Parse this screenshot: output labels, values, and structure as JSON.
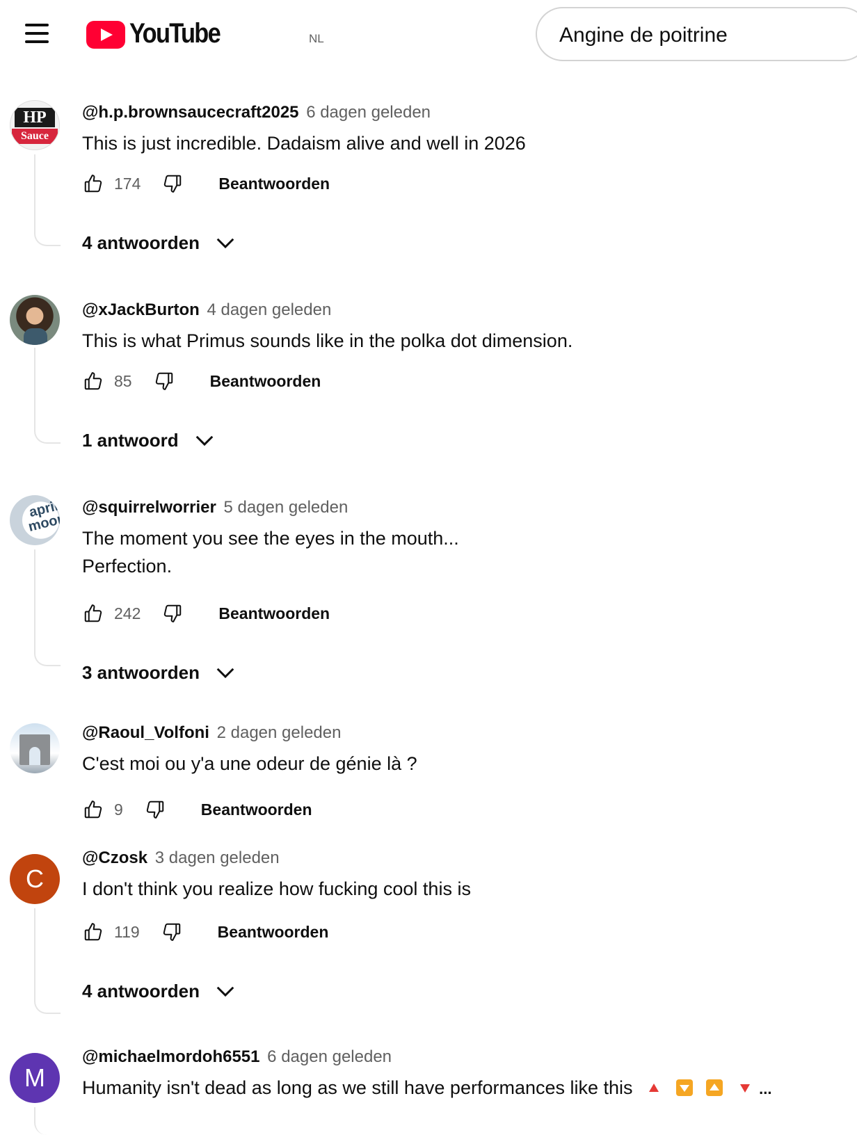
{
  "header": {
    "logo_text": "YouTube",
    "region": "NL",
    "search_value": "Angine de poitrine"
  },
  "comments": [
    {
      "author": "@h.p.brownsaucecraft2025",
      "time": "6 dagen geleden",
      "text": "This is just incredible. Dadaism alive and well in 2026",
      "likes": "174",
      "reply": "Beantwoorden",
      "replies": "4 antwoorden",
      "avatar_top": "HP",
      "avatar_bottom": "Sauce"
    },
    {
      "author": "@xJackBurton",
      "time": "4 dagen geleden",
      "text": "This is what Primus sounds like in the polka dot dimension.",
      "likes": "85",
      "reply": "Beantwoorden",
      "replies": "1 antwoord"
    },
    {
      "author": "@squirrelworrier",
      "time": "5 dagen geleden",
      "text_line1": "The moment you see the eyes in the mouth...",
      "text_line2": "Perfection.",
      "likes": "242",
      "reply": "Beantwoorden",
      "replies": "3 antwoorden",
      "avatar_line1": "april",
      "avatar_line2": "moon"
    },
    {
      "author": "@Raoul_Volfoni",
      "time": "2 dagen geleden",
      "text": "C'est moi ou y'a une odeur de génie là ?",
      "likes": "9",
      "reply": "Beantwoorden"
    },
    {
      "author": "@Czosk",
      "time": "3 dagen geleden",
      "text": "I don't think you realize how fucking cool this is",
      "likes": "119",
      "reply": "Beantwoorden",
      "replies": "4 antwoorden",
      "avatar_letter": "C",
      "avatar_color": "#c1440e"
    },
    {
      "author": "@michaelmordoh6551",
      "time": "6 dagen geleden",
      "text": "Humanity isn't dead as long as we still have performances like this",
      "text_tail": "...",
      "avatar_letter": "M",
      "avatar_color": "#5e35b1"
    }
  ],
  "colors": {
    "brand_red": "#ff0033",
    "text_primary": "#0f0f0f",
    "text_secondary": "#606060",
    "thread_line": "#e5e5e5"
  }
}
